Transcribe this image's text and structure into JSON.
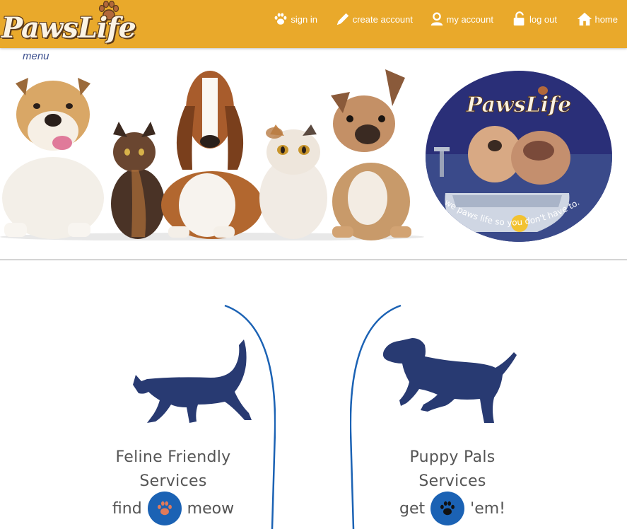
{
  "brand": {
    "logo_text": "PawsLife",
    "colors": {
      "header": "#e9a92b",
      "navy": "#283a72",
      "link": "#3f5290",
      "button": "#1b62b4"
    }
  },
  "nav": {
    "items": [
      {
        "label": "sign in",
        "icon": "paw-icon"
      },
      {
        "label": "create account",
        "icon": "pencil-icon"
      },
      {
        "label": "my account",
        "icon": "user-icon"
      },
      {
        "label": "log out",
        "icon": "unlock-icon"
      },
      {
        "label": "home",
        "icon": "home-icon"
      }
    ]
  },
  "menu_label": "menu",
  "badge": {
    "logo_text": "PawsLife",
    "tagline": "we paws life so you don't have to."
  },
  "cards": [
    {
      "title_line1": "Feline Friendly",
      "title_line2": "Services",
      "action_before": "find",
      "action_after": "meow",
      "silhouette": "cat-silhouette",
      "paw_color": "#e07a5a"
    },
    {
      "title_line1": "Puppy Pals",
      "title_line2": "Services",
      "action_before": "get",
      "action_after": "'em!",
      "silhouette": "dog-silhouette",
      "paw_color": "#111111"
    }
  ]
}
